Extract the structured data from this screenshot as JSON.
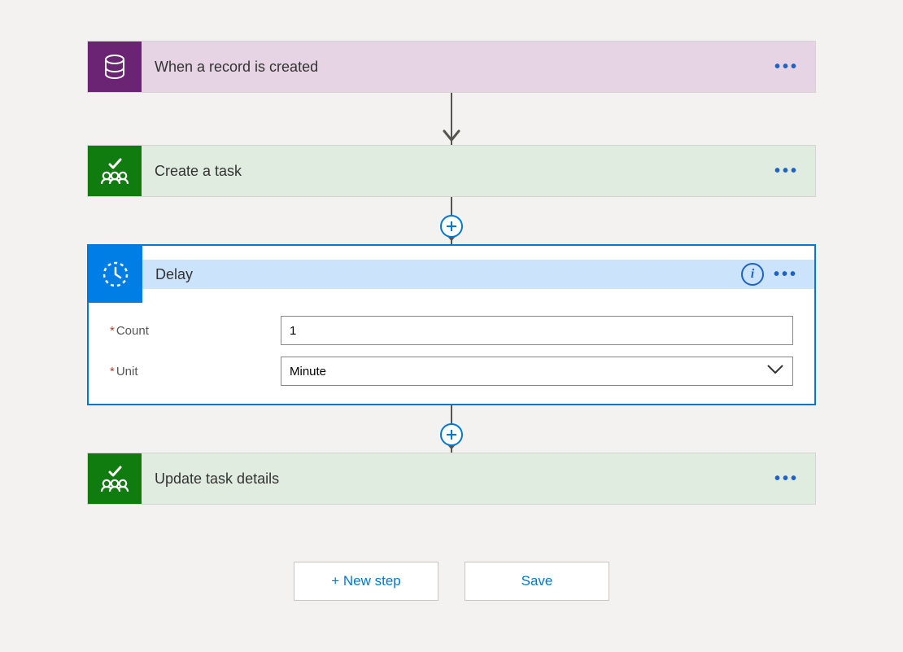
{
  "steps": {
    "trigger": {
      "title": "When a record is created"
    },
    "create_task": {
      "title": "Create a task"
    },
    "delay": {
      "title": "Delay",
      "fields": {
        "count": {
          "label": "Count",
          "value": "1"
        },
        "unit": {
          "label": "Unit",
          "value": "Minute"
        }
      }
    },
    "update_task": {
      "title": "Update task details"
    }
  },
  "footer": {
    "new_step": "+ New step",
    "save": "Save"
  },
  "symbols": {
    "info": "i"
  }
}
